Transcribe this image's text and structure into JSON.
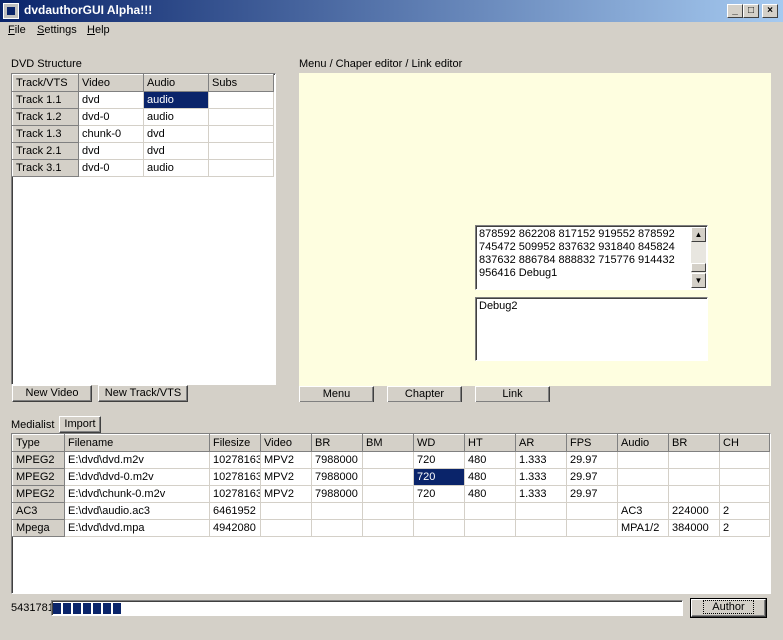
{
  "window": {
    "title": "dvdauthorGUI Alpha!!!",
    "minimize": "_",
    "maximize": "□",
    "close": "×"
  },
  "menu": {
    "file_first": "F",
    "file_rest": "ile",
    "settings_first": "S",
    "settings_rest": "ettings",
    "help_first": "H",
    "help_rest": "elp"
  },
  "dvd_structure": {
    "label": "DVD Structure",
    "columns": [
      "Track/VTS",
      "Video",
      "Audio",
      "Subs"
    ],
    "rows": [
      {
        "track": "Track 1.1",
        "video": "dvd",
        "audio": "audio",
        "subs": ""
      },
      {
        "track": "Track 1.2",
        "video": "dvd-0",
        "audio": "audio",
        "subs": ""
      },
      {
        "track": "Track 1.3",
        "video": "chunk-0",
        "audio": "dvd",
        "subs": ""
      },
      {
        "track": "Track 2.1",
        "video": "dvd",
        "audio": "dvd",
        "subs": ""
      },
      {
        "track": "Track 3.1",
        "video": "dvd-0",
        "audio": "audio",
        "subs": ""
      }
    ],
    "new_video_button": "New Video",
    "new_track_button": "New Track/VTS"
  },
  "editor": {
    "label": "Menu / Chaper editor / Link editor",
    "debug1_lines": [
      "878592 862208 817152 919552 878592",
      "745472 509952 837632 931840 845824",
      "837632 886784 888832 715776 914432",
      "956416 Debug1"
    ],
    "debug2_text": "Debug2",
    "tabs": [
      "Menu",
      "Chapter",
      "Link"
    ]
  },
  "medialist": {
    "label": "Medialist",
    "import_button": "Import",
    "columns": [
      "Type",
      "Filename",
      "Filesize",
      "Video",
      "BR",
      "BM",
      "WD",
      "HT",
      "AR",
      "FPS",
      "Audio",
      "BR",
      "CH"
    ],
    "rows": [
      [
        "MPEG2",
        "E:\\dvd\\dvd.m2v",
        "10278163",
        "MPV2",
        "7988000",
        "",
        "720",
        "480",
        "1.333",
        "29.97",
        "",
        "",
        ""
      ],
      [
        "MPEG2",
        "E:\\dvd\\dvd-0.m2v",
        "10278163",
        "MPV2",
        "7988000",
        "",
        "720",
        "480",
        "1.333",
        "29.97",
        "",
        "",
        ""
      ],
      [
        "MPEG2",
        "E:\\dvd\\chunk-0.m2v",
        "10278163",
        "MPV2",
        "7988000",
        "",
        "720",
        "480",
        "1.333",
        "29.97",
        "",
        "",
        ""
      ],
      [
        "AC3",
        "E:\\dvd\\audio.ac3",
        "6461952",
        "",
        "",
        "",
        "",
        "",
        "",
        "",
        "AC3",
        "224000",
        "2"
      ],
      [
        "Mpega",
        "E:\\dvd\\dvd.mpa",
        "4942080",
        "",
        "",
        "",
        "",
        "",
        "",
        "",
        "MPA1/2",
        "384000",
        "2"
      ]
    ]
  },
  "status": {
    "size_value": "5431781",
    "progress_blocks": 7,
    "author_button": "Author"
  }
}
